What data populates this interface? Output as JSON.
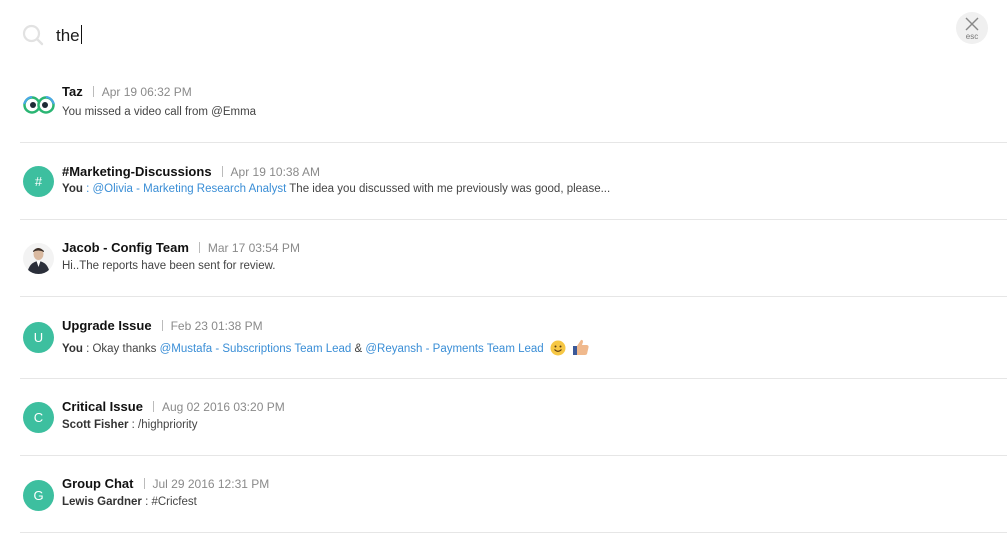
{
  "search": {
    "query": "the",
    "close_label": "esc"
  },
  "results": [
    {
      "title": "Taz",
      "time": "Apr 19 06:32 PM",
      "avatar": "taz-logo-icon",
      "message": "You missed a video call from @Emma"
    },
    {
      "title": "#Marketing-Discussions",
      "time": "Apr 19 10:38 AM",
      "avatar_letter": "#",
      "sender": "You",
      "sender_sep": " : ",
      "mention": "@Olivia - Marketing Research Analyst",
      "message": " The idea you discussed with me previously was good, please..."
    },
    {
      "title": "Jacob - Config Team",
      "time": "Mar 17 03:54 PM",
      "avatar": "person-photo",
      "message": "Hi..The reports have been sent for review."
    },
    {
      "title": "Upgrade Issue",
      "time": "Feb 23 01:38 PM",
      "avatar_letter": "U",
      "sender": "You",
      "sender_sep": " : Okay thanks ",
      "mention1": "@Mustafa - Subscriptions Team Lead",
      "join": " & ",
      "mention2": "@Reyansh - Payments Team Lead",
      "emojis": [
        "smile-emoji-icon",
        "thumbs-up-emoji-icon"
      ]
    },
    {
      "title": "Critical Issue",
      "time": "Aug 02 2016 03:20 PM",
      "avatar_letter": "C",
      "sender": "Scott Fisher",
      "message": " : /highpriority"
    },
    {
      "title": "Group Chat",
      "time": "Jul 29 2016 12:31 PM",
      "avatar_letter": "G",
      "sender": "Lewis Gardner",
      "message": " : #Cricfest"
    }
  ],
  "colors": {
    "avatar_green": "#3dbf9f",
    "mention_blue": "#3a8ed6"
  }
}
